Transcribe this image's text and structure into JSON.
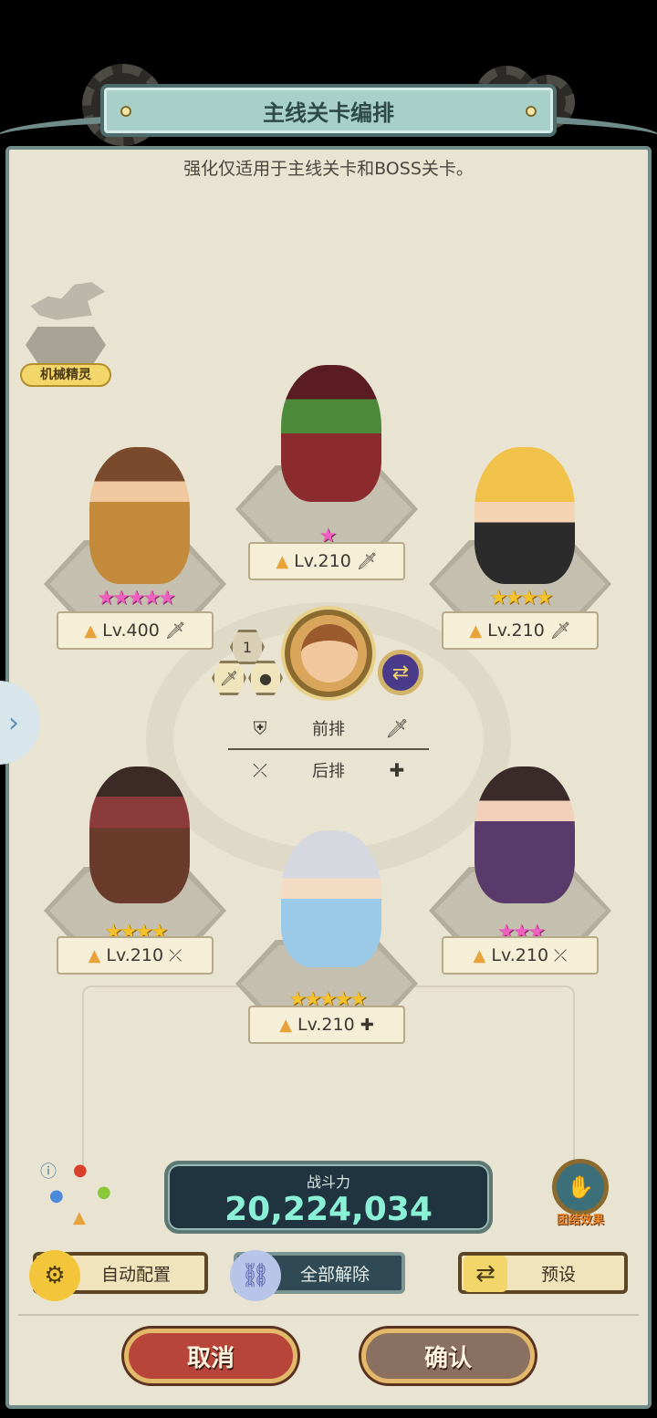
{
  "header": {
    "title": "主线关卡编排",
    "subtitle": "强化仅适用于主线关卡和BOSS关卡。"
  },
  "spirit": {
    "label": "机械精灵"
  },
  "colors": {
    "gold_star": "#f5c22a",
    "pink_star": "#ef5fbf",
    "power_value": "#8af1d6"
  },
  "slots": [
    {
      "stars": "★★★★★",
      "star_color": "pink",
      "level": "Lv.400",
      "role_icon": "sword-icon",
      "role_glyph": "🗡"
    },
    {
      "stars": "★",
      "star_color": "pink",
      "level": "Lv.210",
      "role_icon": "sword-icon",
      "role_glyph": "🗡"
    },
    {
      "stars": "★★★★",
      "star_color": "gold",
      "level": "Lv.210",
      "role_icon": "sword-icon",
      "role_glyph": "🗡"
    },
    {
      "stars": "★★★★",
      "star_color": "gold",
      "level": "Lv.210",
      "role_icon": "crossed-arrows-icon",
      "role_glyph": "⤫"
    },
    {
      "stars": "★★★★★",
      "star_color": "gold",
      "level": "Lv.210",
      "role_icon": "plus-icon",
      "role_glyph": "✚"
    },
    {
      "stars": "★★★",
      "star_color": "pink",
      "level": "Lv.210",
      "role_icon": "crossed-arrows-icon",
      "role_glyph": "⤫"
    }
  ],
  "leader": {
    "rank_badge": "1"
  },
  "legend": {
    "front": "前排",
    "back": "后排"
  },
  "power": {
    "label": "战斗力",
    "value": "20,224,034"
  },
  "synergy": {
    "label": "团结效果"
  },
  "buttons": {
    "auto": "自动配置",
    "clear": "全部解除",
    "preset": "预设",
    "cancel": "取消",
    "confirm": "确认"
  }
}
